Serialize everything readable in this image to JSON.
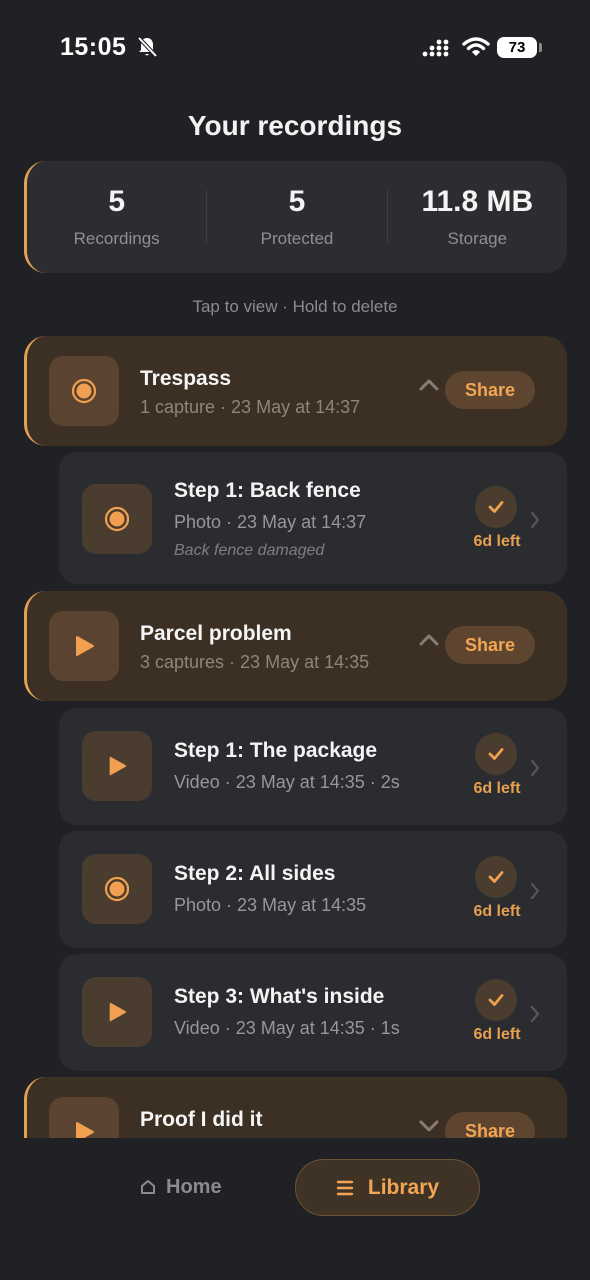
{
  "status": {
    "time": "15:05",
    "battery": "73"
  },
  "page_title": "Your recordings",
  "stats": [
    {
      "value": "5",
      "label": "Recordings"
    },
    {
      "value": "5",
      "label": "Protected"
    },
    {
      "value": "11.8 MB",
      "label": "Storage"
    }
  ],
  "hint": "Tap to view · Hold to delete",
  "groups": [
    {
      "title": "Trespass",
      "subtitle": "1 capture · 23 May at 14:37",
      "icon": "record-icon",
      "share_label": "Share",
      "items": [
        {
          "title": "Step 1: Back fence",
          "subtitle": "Photo · 23 May at 14:37",
          "note": "Back fence damaged",
          "icon": "record-icon",
          "days_left": "6d left"
        }
      ]
    },
    {
      "title": "Parcel problem",
      "subtitle": "3 captures · 23 May at 14:35",
      "icon": "play-icon",
      "share_label": "Share",
      "items": [
        {
          "title": "Step 1: The package",
          "subtitle": "Video · 23 May at 14:35 · 2s",
          "icon": "play-icon",
          "days_left": "6d left"
        },
        {
          "title": "Step 2: All sides",
          "subtitle": "Photo · 23 May at 14:35",
          "icon": "record-icon",
          "days_left": "6d left"
        },
        {
          "title": "Step 3: What's inside",
          "subtitle": "Video · 23 May at 14:35 · 1s",
          "icon": "play-icon",
          "days_left": "6d left"
        }
      ]
    },
    {
      "title": "Proof I did it",
      "icon": "play-icon",
      "share_label": "Share"
    }
  ],
  "nav": {
    "home": "Home",
    "library": "Library"
  },
  "colors": {
    "accent": "#E5A055",
    "background": "#202124",
    "card": "#2B2C30",
    "group_card": "#3C3025"
  }
}
